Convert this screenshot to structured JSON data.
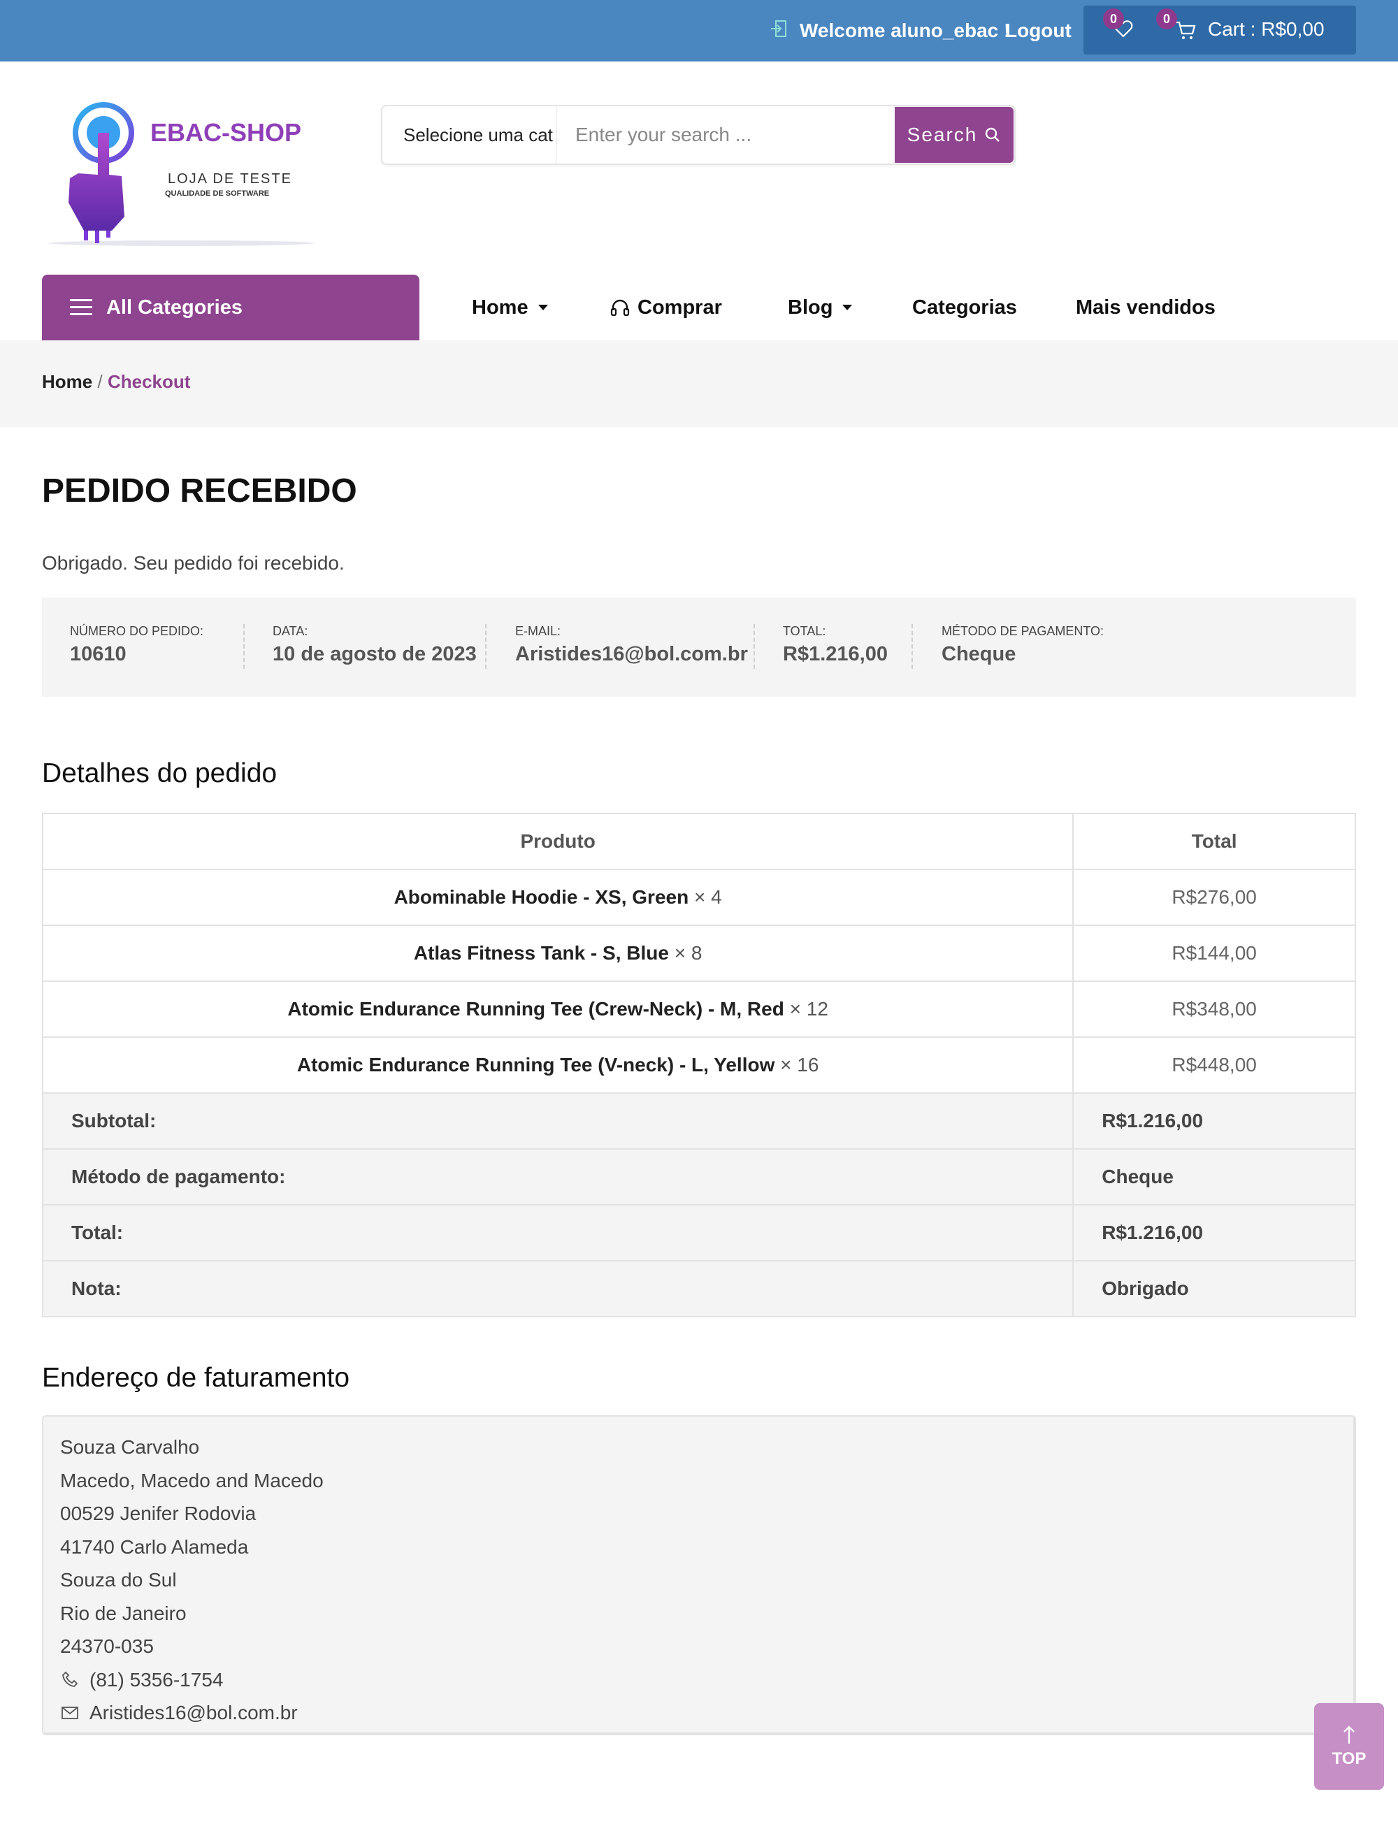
{
  "topbar": {
    "welcome": "Welcome aluno_ebac !",
    "logout": "Logout",
    "wishlist_count": "0",
    "cart_count": "0",
    "cart_label": "Cart : R$0,00"
  },
  "logo": {
    "brand": "EBAC-SHOP",
    "tagline": "LOJA DE TESTE",
    "subtagline": "QUALIDADE DE SOFTWARE"
  },
  "search": {
    "category": "Selecione uma cat",
    "placeholder": "Enter your search ...",
    "button": "Search"
  },
  "nav": {
    "all_categories": "All Categories",
    "items": [
      "Home",
      "Comprar",
      "Blog",
      "Categorias",
      "Mais vendidos"
    ]
  },
  "breadcrumb": {
    "home": "Home",
    "separator": "/",
    "current": "Checkout"
  },
  "page": {
    "title": "PEDIDO RECEBIDO",
    "thanks": "Obrigado. Seu pedido foi recebido."
  },
  "overview": [
    {
      "label": "NÚMERO DO PEDIDO:",
      "value": "10610"
    },
    {
      "label": "DATA:",
      "value": "10 de agosto de 2023"
    },
    {
      "label": "E-MAIL:",
      "value": "Aristides16@bol.com.br"
    },
    {
      "label": "TOTAL:",
      "value": "R$1.216,00"
    },
    {
      "label": "MÉTODO DE PAGAMENTO:",
      "value": "Cheque"
    }
  ],
  "details": {
    "heading": "Detalhes do pedido",
    "col_product": "Produto",
    "col_total": "Total",
    "items": [
      {
        "name": "Abominable Hoodie - XS, Green",
        "qty": "× 4",
        "total": "R$276,00"
      },
      {
        "name": "Atlas Fitness Tank - S, Blue",
        "qty": "× 8",
        "total": "R$144,00"
      },
      {
        "name": "Atomic Endurance Running Tee (Crew-Neck) - M, Red",
        "qty": "× 12",
        "total": "R$348,00"
      },
      {
        "name": "Atomic Endurance Running Tee (V-neck) - L, Yellow",
        "qty": "× 16",
        "total": "R$448,00"
      }
    ],
    "footer": [
      {
        "label": "Subtotal:",
        "value": "R$1.216,00"
      },
      {
        "label": "Método de pagamento:",
        "value": "Cheque"
      },
      {
        "label": "Total:",
        "value": "R$1.216,00"
      },
      {
        "label": "Nota:",
        "value": "Obrigado"
      }
    ]
  },
  "billing": {
    "heading": "Endereço de faturamento",
    "lines": [
      "Souza Carvalho",
      "Macedo, Macedo and Macedo",
      "00529 Jenifer Rodovia",
      "41740 Carlo Alameda",
      "Souza do Sul",
      "Rio de Janeiro",
      "24370-035"
    ],
    "phone": "(81) 5356-1754",
    "email": "Aristides16@bol.com.br"
  },
  "top_button": "TOP",
  "colors": {
    "topbar": "#4a86c0",
    "accent": "#8e448e",
    "top_button": "#c68fc6"
  }
}
